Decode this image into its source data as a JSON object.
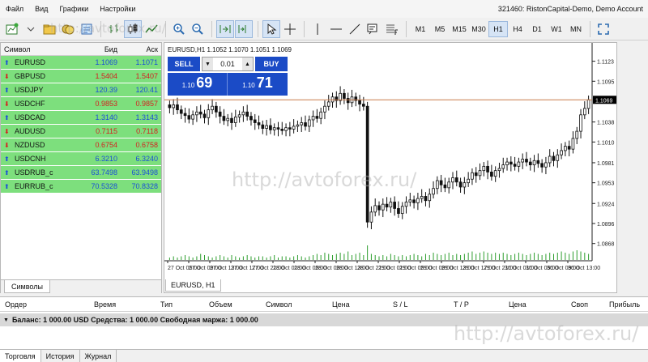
{
  "menu": [
    "Файл",
    "Вид",
    "Графики",
    "Настройки"
  ],
  "account_label": "321460: RistonCapital-Demo, Demo Account",
  "timeframes": [
    "M1",
    "M5",
    "M15",
    "M30",
    "H1",
    "H4",
    "D1",
    "W1",
    "MN"
  ],
  "active_timeframe": "H1",
  "market_watch": {
    "headers": [
      "Символ",
      "Бид",
      "Аск"
    ],
    "rows": [
      {
        "symbol": "EURUSD",
        "bid": "1.1069",
        "ask": "1.1071",
        "dir": "up"
      },
      {
        "symbol": "GBPUSD",
        "bid": "1.5404",
        "ask": "1.5407",
        "dir": "down"
      },
      {
        "symbol": "USDJPY",
        "bid": "120.39",
        "ask": "120.41",
        "dir": "up"
      },
      {
        "symbol": "USDCHF",
        "bid": "0.9853",
        "ask": "0.9857",
        "dir": "down"
      },
      {
        "symbol": "USDCAD",
        "bid": "1.3140",
        "ask": "1.3143",
        "dir": "up"
      },
      {
        "symbol": "AUDUSD",
        "bid": "0.7115",
        "ask": "0.7118",
        "dir": "down"
      },
      {
        "symbol": "NZDUSD",
        "bid": "0.6754",
        "ask": "0.6758",
        "dir": "down"
      },
      {
        "symbol": "USDCNH",
        "bid": "6.3210",
        "ask": "6.3240",
        "dir": "up"
      },
      {
        "symbol": "USDRUB_c",
        "bid": "63.7498",
        "ask": "63.9498",
        "dir": "up"
      },
      {
        "symbol": "EURRUB_c",
        "bid": "70.5328",
        "ask": "70.8328",
        "dir": "up"
      }
    ],
    "tab_label": "Символы"
  },
  "chart": {
    "title": "EURUSD,H1  1.1052 1.1070 1.1051 1.1069",
    "tab_label": "EURUSD, H1",
    "one_click": {
      "sell_label": "SELL",
      "buy_label": "BUY",
      "lot": "0.01",
      "sell_small": "1.10",
      "sell_big": "69",
      "buy_small": "1.10",
      "buy_big": "71"
    }
  },
  "chart_data": {
    "type": "candlestick",
    "ylim": [
      1.0845,
      1.1135
    ],
    "price_line": 1.1069,
    "price_line_label": "1.1069",
    "y_ticks": [
      "1.1123",
      "1.1095",
      "1.1069",
      "1.1038",
      "1.1010",
      "1.0981",
      "1.0953",
      "1.0924",
      "1.0896",
      "1.0868"
    ],
    "x_ticks": [
      "27 Oct 05:00",
      "27 Oct 09:00",
      "27 Oct 13:00",
      "27 Oct 17:00",
      "27 Oct 21:00",
      "28 Oct 01:00",
      "28 Oct 05:00",
      "28 Oct 09:00",
      "28 Oct 13:00",
      "28 Oct 21:00",
      "29 Oct 01:00",
      "29 Oct 05:00",
      "29 Oct 09:00",
      "29 Oct 13:00",
      "29 Oct 17:00",
      "29 Oct 21:00",
      "30 Oct 01:00",
      "30 Oct 05:00",
      "30 Oct 09:00",
      "30 Oct 13:00"
    ],
    "close": [
      1.1058,
      1.1062,
      1.1055,
      1.105,
      1.1047,
      1.1042,
      1.1048,
      1.1052,
      1.1049,
      1.1044,
      1.1055,
      1.106,
      1.1052,
      1.1046,
      1.104,
      1.1043,
      1.1037,
      1.1045,
      1.1048,
      1.1052,
      1.1046,
      1.1041,
      1.1037,
      1.1034,
      1.1029,
      1.1033,
      1.1027,
      1.103,
      1.1028,
      1.1026,
      1.103,
      1.1028,
      1.1032,
      1.1034,
      1.1037,
      1.1032,
      1.1041,
      1.1046,
      1.1043,
      1.1052,
      1.106,
      1.1066,
      1.1073,
      1.1068,
      1.1078,
      1.1071,
      1.1065,
      1.1073,
      1.1068,
      1.1063,
      1.106,
      1.0898,
      1.0912,
      1.0921,
      1.0915,
      1.0923,
      1.0919,
      1.0926,
      1.0917,
      1.091,
      1.092,
      1.0926,
      1.0929,
      1.0925,
      1.0931,
      1.0934,
      1.0928,
      1.0937,
      1.0945,
      1.0956,
      1.095,
      1.0946,
      1.0954,
      1.096,
      1.0954,
      1.0947,
      1.0953,
      1.0958,
      1.0967,
      1.0963,
      1.097,
      1.0976,
      1.0968,
      1.0962,
      1.097,
      1.0973,
      1.0978,
      1.0982,
      1.0979,
      1.0976,
      1.0982,
      1.0986,
      1.0982,
      1.0978,
      1.0984,
      1.098,
      1.0975,
      1.0981,
      1.099,
      1.0984,
      1.0992,
      1.0998,
      1.1004,
      1.1,
      1.1015,
      1.1025,
      1.1048,
      1.1057,
      1.1069
    ],
    "volumes": [
      2,
      3,
      2,
      3,
      4,
      3,
      2,
      3,
      5,
      4,
      3,
      2,
      3,
      4,
      3,
      2,
      4,
      3,
      2,
      3,
      4,
      3,
      2,
      3,
      3,
      2,
      3,
      4,
      2,
      3,
      3,
      2,
      3,
      4,
      3,
      2,
      3,
      4,
      5,
      4,
      6,
      5,
      4,
      5,
      6,
      5,
      7,
      4,
      5,
      6,
      4,
      12,
      5,
      4,
      3,
      4,
      3,
      5,
      4,
      3,
      4,
      3,
      4,
      5,
      4,
      3,
      5,
      4,
      6,
      5,
      4,
      5,
      6,
      4,
      5,
      4,
      5,
      6,
      7,
      5,
      6,
      7,
      6,
      5,
      6,
      5,
      6,
      5,
      4,
      5,
      6,
      5,
      4,
      5,
      6,
      5,
      4,
      5,
      6,
      5,
      6,
      7,
      6,
      5,
      7,
      8,
      7,
      6,
      5
    ]
  },
  "terminal": {
    "columns": [
      "Ордер",
      "Время",
      "Тип",
      "Объем",
      "Символ",
      "Цена",
      "S / L",
      "T / P",
      "Цена",
      "Своп",
      "Прибыль"
    ],
    "balance_line": "Баланс: 1 000.00 USD  Средства: 1 000.00  Свободная маржа: 1 000.00",
    "tabs": [
      "Торговля",
      "История",
      "Журнал"
    ]
  },
  "watermark_text": "http://avtoforex.ru/"
}
